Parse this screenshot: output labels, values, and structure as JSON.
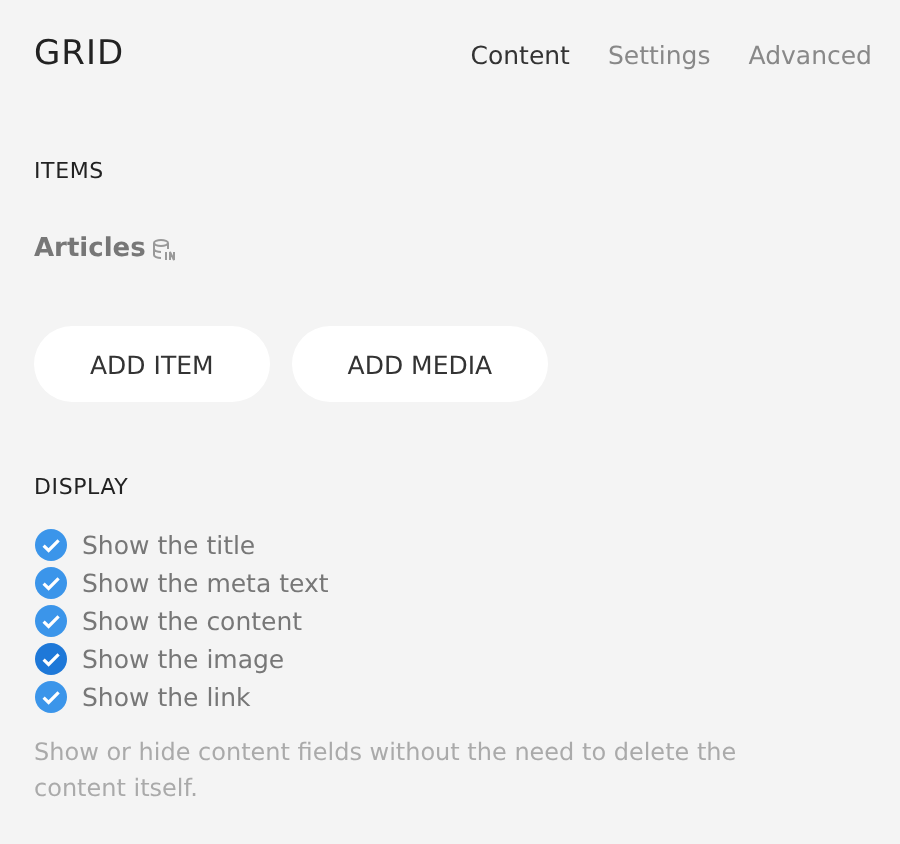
{
  "header": {
    "title": "GRID",
    "tabs": [
      {
        "label": "Content",
        "selected": true
      },
      {
        "label": "Settings",
        "selected": false
      },
      {
        "label": "Advanced",
        "selected": false
      }
    ]
  },
  "items_section": {
    "heading": "ITEMS",
    "source": "Articles",
    "buttons": [
      "ADD ITEM",
      "ADD MEDIA"
    ]
  },
  "display_section": {
    "heading": "DISPLAY",
    "options": [
      {
        "label": "Show the title",
        "checked": true,
        "focused": false
      },
      {
        "label": "Show the meta text",
        "checked": true,
        "focused": false
      },
      {
        "label": "Show the content",
        "checked": true,
        "focused": false
      },
      {
        "label": "Show the image",
        "checked": true,
        "focused": true
      },
      {
        "label": "Show the link",
        "checked": true,
        "focused": false
      }
    ],
    "help": "Show or hide content fields without the need to delete the content itself."
  }
}
